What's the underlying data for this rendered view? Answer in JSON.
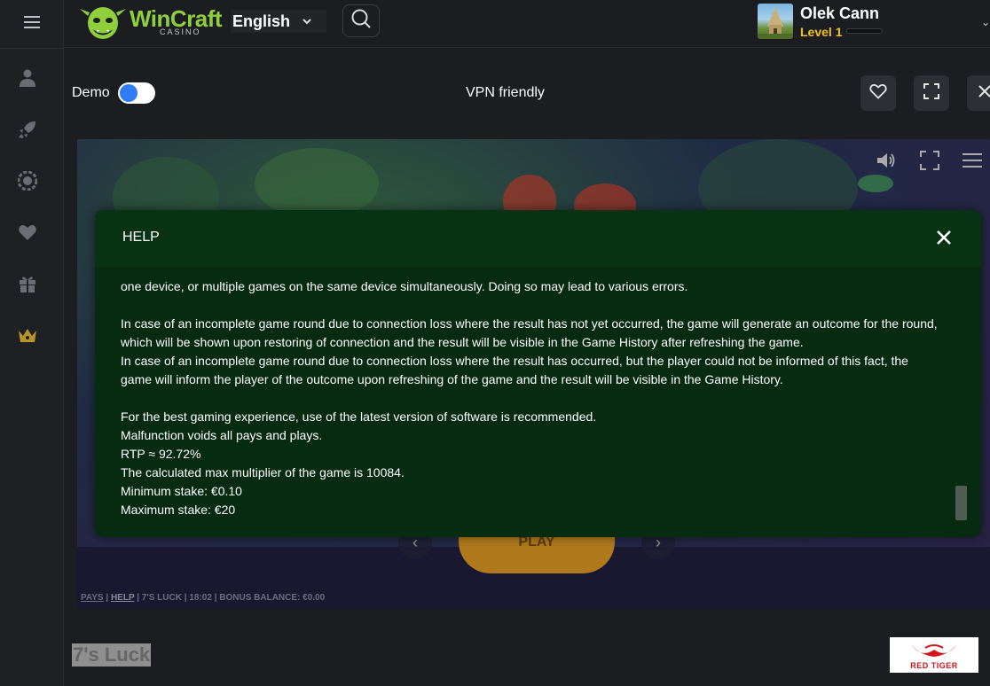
{
  "app": {
    "brand": "WinCraft",
    "brand_sub": "CASINO"
  },
  "header": {
    "language": "English",
    "user": {
      "name": "Olek Cann",
      "level": "Level 1",
      "level_progress": 0
    }
  },
  "toolbar": {
    "demo_label": "Demo",
    "demo_enabled": true,
    "vpn_label": "VPN friendly"
  },
  "sidebar": {
    "items": [
      {
        "icon": "user-icon"
      },
      {
        "icon": "rocket-icon"
      },
      {
        "icon": "chip-icon"
      },
      {
        "icon": "heart-icon"
      },
      {
        "icon": "gift-icon"
      },
      {
        "icon": "crown-icon"
      }
    ]
  },
  "game": {
    "play_label": "PLAY",
    "footer": {
      "pays": "PAYS",
      "help": "HELP",
      "name": "7'S LUCK",
      "time": "18:02",
      "bonus": "BONUS BALANCE: €0.00"
    }
  },
  "help_modal": {
    "title": "HELP",
    "lines": [
      "one device, or multiple games on the same device simultaneously. Doing so may lead to various errors.",
      "",
      "In case of an incomplete game round due to connection loss where the result has not yet occurred, the game will generate an outcome for the round,",
      "which will be shown upon restoring of connection and the result will be visible in the Game History after refreshing the game.",
      "In case of an incomplete game round due to connection loss where the result has occurred, but the player could not be informed of this fact, the",
      "game will inform the player of the outcome upon refreshing of the game and the result will be visible in the Game History.",
      "",
      "For the best gaming experience, use of the latest version of software is recommended.",
      "Malfunction voids all pays and plays.",
      "RTP ≈ 92.72%",
      "The calculated max multiplier of the game is 10084.",
      "Minimum stake: €0.10",
      "Maximum stake: €20"
    ]
  },
  "page": {
    "game_title": "7's Luck",
    "provider": "RED TIGER"
  },
  "colors": {
    "accent_green": "#8fcf3c",
    "level_gold": "#f2c21b",
    "toggle_blue": "#2f7cf6",
    "modal_bg": "#062b10"
  }
}
